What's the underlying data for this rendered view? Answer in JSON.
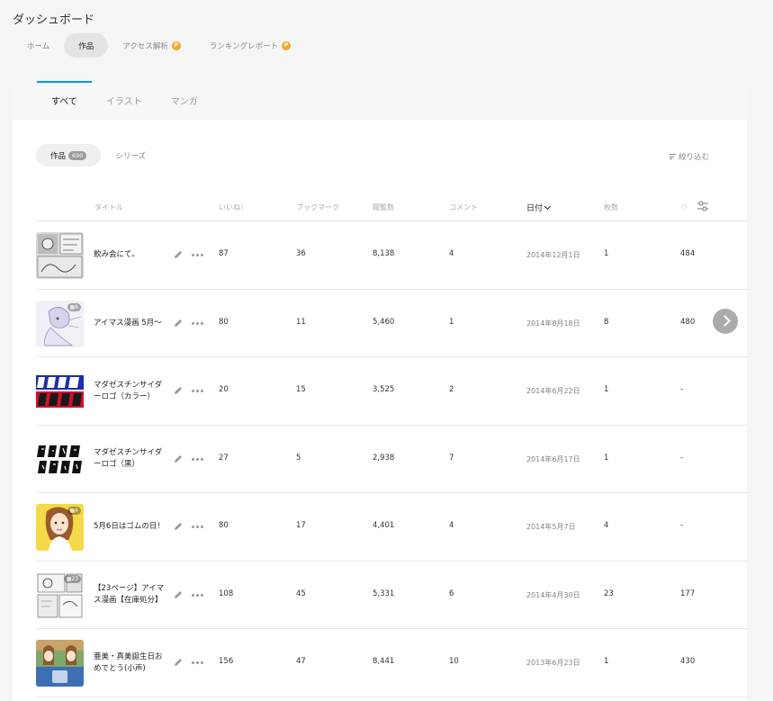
{
  "page": {
    "title": "ダッシュボード"
  },
  "top_tabs": [
    {
      "label": "ホーム",
      "active": false
    },
    {
      "label": "作品",
      "active": true
    },
    {
      "label": "アクセス解析",
      "active": false,
      "badge_icon": "premium-icon"
    },
    {
      "label": "ランキングレポート",
      "active": false,
      "badge_icon": "premium-icon"
    }
  ],
  "content_tabs": [
    {
      "label": "すべて",
      "active": true
    },
    {
      "label": "イラスト",
      "active": false
    },
    {
      "label": "マンガ",
      "active": false
    }
  ],
  "filters": {
    "works_label": "作品",
    "works_count": "690",
    "series_label": "シリーズ",
    "narrow_label": "絞り込む"
  },
  "table": {
    "headers": {
      "title": "タイトル",
      "likes": "いいね！",
      "bookmarks": "ブックマーク",
      "views": "閲覧数",
      "comments": "コメント",
      "date": "日付",
      "pages": "枚数",
      "rank": "ラ"
    },
    "rows": [
      {
        "title": "飲み会にて。",
        "likes": "87",
        "bookmarks": "36",
        "views": "8,138",
        "comments": "4",
        "date": "2014年12月1日",
        "pages": "1",
        "rank": "484",
        "page_badge": ""
      },
      {
        "title": "アイマス漫画 5月～",
        "likes": "80",
        "bookmarks": "11",
        "views": "5,460",
        "comments": "1",
        "date": "2014年8月18日",
        "pages": "8",
        "rank": "480",
        "page_badge": "8"
      },
      {
        "title": "マダゼスチンサイダーロゴ（カラー）",
        "likes": "20",
        "bookmarks": "15",
        "views": "3,525",
        "comments": "2",
        "date": "2014年6月22日",
        "pages": "1",
        "rank": "-",
        "page_badge": ""
      },
      {
        "title": "マダゼスチンサイダーロゴ（黒）",
        "likes": "27",
        "bookmarks": "5",
        "views": "2,938",
        "comments": "7",
        "date": "2014年6月17日",
        "pages": "1",
        "rank": "-",
        "page_badge": ""
      },
      {
        "title": "5月6日はゴムの日！",
        "likes": "80",
        "bookmarks": "17",
        "views": "4,401",
        "comments": "4",
        "date": "2014年5月7日",
        "pages": "4",
        "rank": "-",
        "page_badge": "4"
      },
      {
        "title": "【23ページ】アイマス漫画【在庫処分】",
        "likes": "108",
        "bookmarks": "45",
        "views": "5,331",
        "comments": "6",
        "date": "2014年4月30日",
        "pages": "23",
        "rank": "177",
        "page_badge": "23"
      },
      {
        "title": "亜美・真美誕生日おめでとう(小声)",
        "likes": "156",
        "bookmarks": "47",
        "views": "8,441",
        "comments": "10",
        "date": "2013年6月23日",
        "pages": "1",
        "rank": "430",
        "page_badge": ""
      }
    ]
  },
  "colors": {
    "accent": "#0096fa",
    "premium": "#f5a623"
  }
}
